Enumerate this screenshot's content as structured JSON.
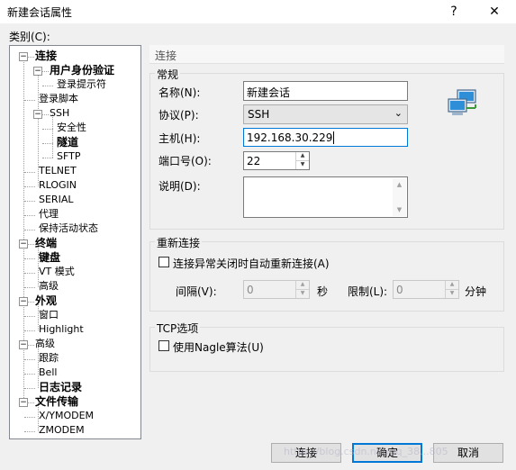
{
  "window": {
    "title": "新建会话属性",
    "help": "?",
    "close": "✕"
  },
  "category_label": "类别(C):",
  "tree": [
    {
      "label": "连接",
      "bold": true
    },
    {
      "label": "用户身份验证",
      "bold": true
    },
    {
      "label": "登录提示符",
      "bold": false
    },
    {
      "label": "登录脚本",
      "bold": false
    },
    {
      "label": "SSH",
      "bold": false
    },
    {
      "label": "安全性",
      "bold": false
    },
    {
      "label": "隧道",
      "bold": true
    },
    {
      "label": "SFTP",
      "bold": false
    },
    {
      "label": "TELNET",
      "bold": false
    },
    {
      "label": "RLOGIN",
      "bold": false
    },
    {
      "label": "SERIAL",
      "bold": false
    },
    {
      "label": "代理",
      "bold": false
    },
    {
      "label": "保持活动状态",
      "bold": false
    },
    {
      "label": "终端",
      "bold": true
    },
    {
      "label": "键盘",
      "bold": true
    },
    {
      "label": "VT 模式",
      "bold": false
    },
    {
      "label": "高级",
      "bold": false
    },
    {
      "label": "外观",
      "bold": true
    },
    {
      "label": "窗口",
      "bold": false
    },
    {
      "label": "Highlight",
      "bold": false
    },
    {
      "label": "高级",
      "bold": false
    },
    {
      "label": "跟踪",
      "bold": false
    },
    {
      "label": "Bell",
      "bold": false
    },
    {
      "label": "日志记录",
      "bold": true
    },
    {
      "label": "文件传输",
      "bold": true
    },
    {
      "label": "X/YMODEM",
      "bold": false
    },
    {
      "label": "ZMODEM",
      "bold": false
    }
  ],
  "header": "连接",
  "general": {
    "group": "常规",
    "name_label": "名称(N):",
    "name_value": "新建会话",
    "protocol_label": "协议(P):",
    "protocol_value": "SSH",
    "host_label": "主机(H):",
    "host_value": "192.168.30.229",
    "port_label": "端口号(O):",
    "port_value": "22",
    "desc_label": "说明(D):",
    "desc_value": ""
  },
  "reconnect": {
    "group": "重新连接",
    "checkbox_label": "连接异常关闭时自动重新连接(A)",
    "interval_label": "间隔(V):",
    "interval_value": "0",
    "sec_unit": "秒",
    "limit_label": "限制(L):",
    "limit_value": "0",
    "min_unit": "分钟"
  },
  "tcp": {
    "group": "TCP选项",
    "nagle_label": "使用Nagle算法(U)"
  },
  "buttons": {
    "connect": "连接",
    "ok": "确定",
    "cancel": "取消"
  },
  "watermark": "https://blog.csdn.net/qq_38...805"
}
